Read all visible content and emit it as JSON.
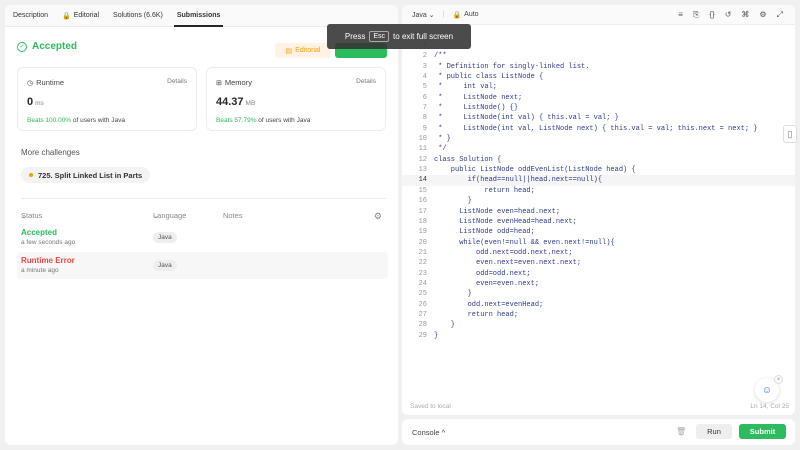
{
  "tabs": [
    {
      "label": "Description",
      "active": false,
      "locked": false
    },
    {
      "label": "Editorial",
      "active": false,
      "locked": true
    },
    {
      "label": "Solutions (6.6K)",
      "active": false,
      "locked": false
    },
    {
      "label": "Submissions",
      "active": true,
      "locked": false
    }
  ],
  "result": {
    "status": "Accepted",
    "editorial_label": "Editorial"
  },
  "runtime": {
    "title": "Runtime",
    "details": "Details",
    "value": "0",
    "unit": "ms",
    "beats_pct": "Beats 100.00%",
    "beats_suffix": "of users with Java"
  },
  "memory": {
    "title": "Memory",
    "details": "Details",
    "value": "44.37",
    "unit": "MB",
    "beats_pct": "Beats 57.79%",
    "beats_suffix": "of users with Java"
  },
  "more_challenges": {
    "label": "More challenges",
    "item": "725. Split Linked List in Parts"
  },
  "submissions_table": {
    "headers": {
      "status": "Status",
      "language": "Language",
      "notes": "Notes"
    },
    "rows": [
      {
        "status": "Accepted",
        "time": "a few seconds ago",
        "language": "Java",
        "status_color": "#2cbb5d"
      },
      {
        "status": "Runtime Error",
        "time": "a minute ago",
        "language": "Java",
        "status_color": "#ef4743"
      }
    ]
  },
  "editor": {
    "language": "Java",
    "mode": "Auto",
    "saved_label": "Saved to local",
    "cursor_pos": "Ln 14, Col 25",
    "current_line": 14,
    "lines": [
      {
        "n": "1",
        "code": ""
      },
      {
        "n": "2",
        "code": "/**"
      },
      {
        "n": "3",
        "code": " * Definition for singly-linked list."
      },
      {
        "n": "4",
        "code": " * public class ListNode {"
      },
      {
        "n": "5",
        "code": " *     int val;"
      },
      {
        "n": "6",
        "code": " *     ListNode next;"
      },
      {
        "n": "7",
        "code": " *     ListNode() {}"
      },
      {
        "n": "8",
        "code": " *     ListNode(int val) { this.val = val; }"
      },
      {
        "n": "9",
        "code": " *     ListNode(int val, ListNode next) { this.val = val; this.next = next; }"
      },
      {
        "n": "10",
        "code": " * }"
      },
      {
        "n": "11",
        "code": " */"
      },
      {
        "n": "12",
        "code": "class Solution {"
      },
      {
        "n": "13",
        "code": "    public ListNode oddEvenList(ListNode head) {"
      },
      {
        "n": "14",
        "code": "        if(head==null||head.next==null){"
      },
      {
        "n": "15",
        "code": "            return head;"
      },
      {
        "n": "16",
        "code": "        }"
      },
      {
        "n": "17",
        "code": "      ListNode even=head.next;"
      },
      {
        "n": "18",
        "code": "      ListNode evenHead=head.next;"
      },
      {
        "n": "19",
        "code": "      ListNode odd=head;"
      },
      {
        "n": "20",
        "code": "      while(even!=null && even.next!=null){"
      },
      {
        "n": "21",
        "code": "          odd.next=odd.next.next;"
      },
      {
        "n": "22",
        "code": "          even.next=even.next.next;"
      },
      {
        "n": "23",
        "code": "          odd=odd.next;"
      },
      {
        "n": "24",
        "code": "          even=even.next;"
      },
      {
        "n": "25",
        "code": "        }"
      },
      {
        "n": "26",
        "code": "        odd.next=evenHead;"
      },
      {
        "n": "27",
        "code": "        return head;"
      },
      {
        "n": "28",
        "code": "    }"
      },
      {
        "n": "29",
        "code": "}"
      }
    ]
  },
  "fullscreen_notice": {
    "before": "Press",
    "key": "Esc",
    "after": "to exit full screen"
  },
  "console": {
    "label": "Console",
    "run_label": "Run",
    "submit_label": "Submit"
  },
  "colors": {
    "accent_green": "#2cbb5d",
    "error_red": "#ef4743",
    "editorial_orange": "#f59e0b"
  }
}
